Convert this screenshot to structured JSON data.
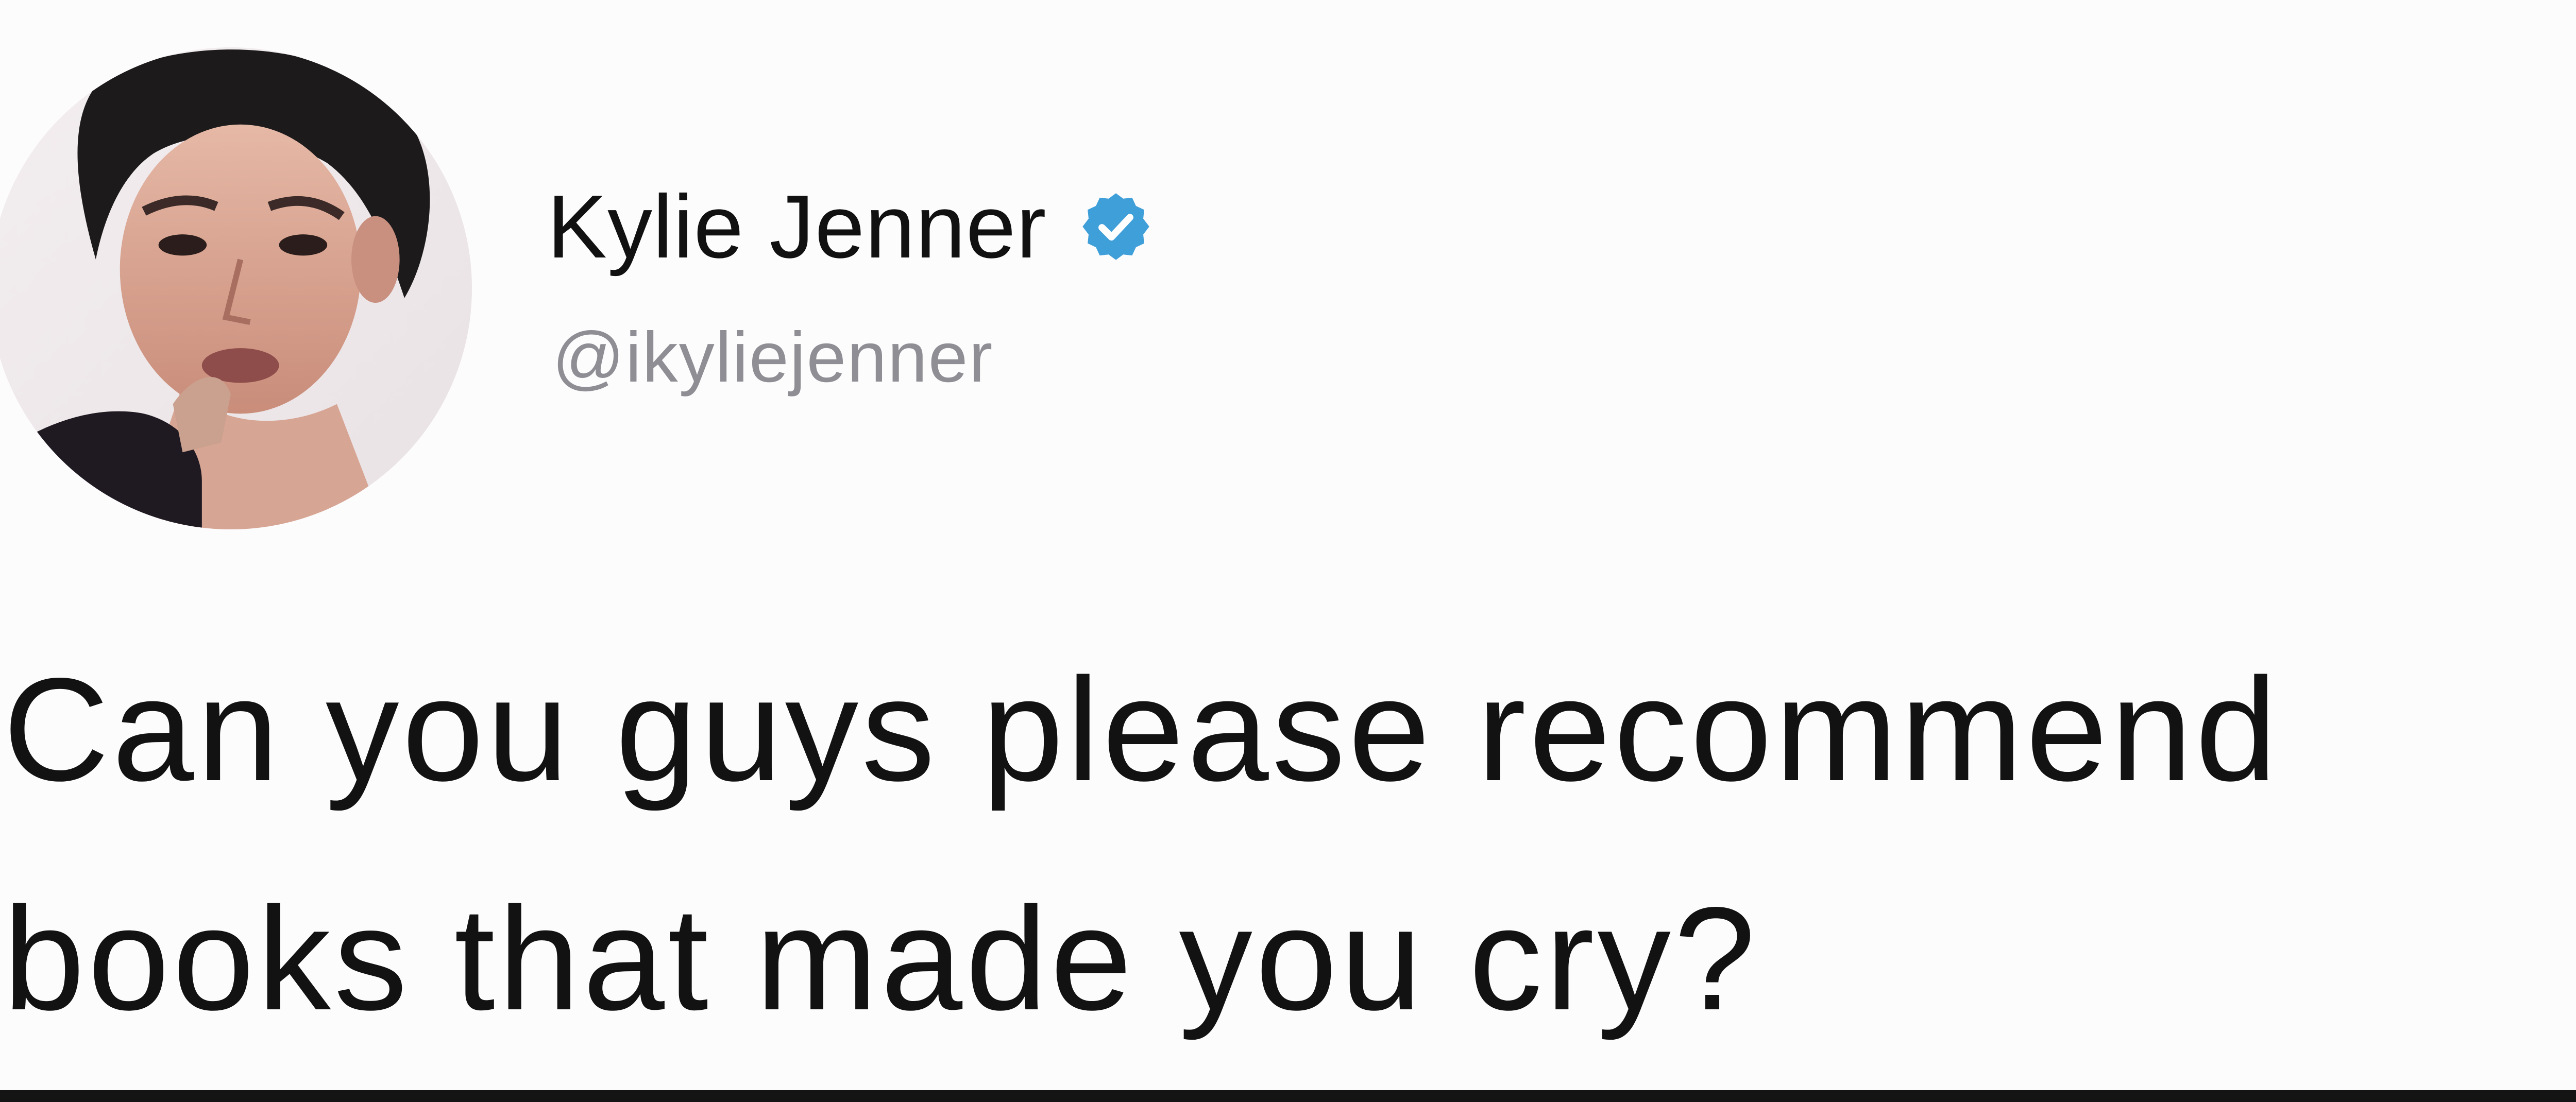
{
  "tweet": {
    "author": {
      "display_name": "Kylie Jenner",
      "handle": "@ikyliejenner",
      "verified": true,
      "verified_icon": "verified-badge-icon",
      "verified_color": "#3f9fd9"
    },
    "text": "Can you guys please recommend\nbooks that made you cry?"
  }
}
